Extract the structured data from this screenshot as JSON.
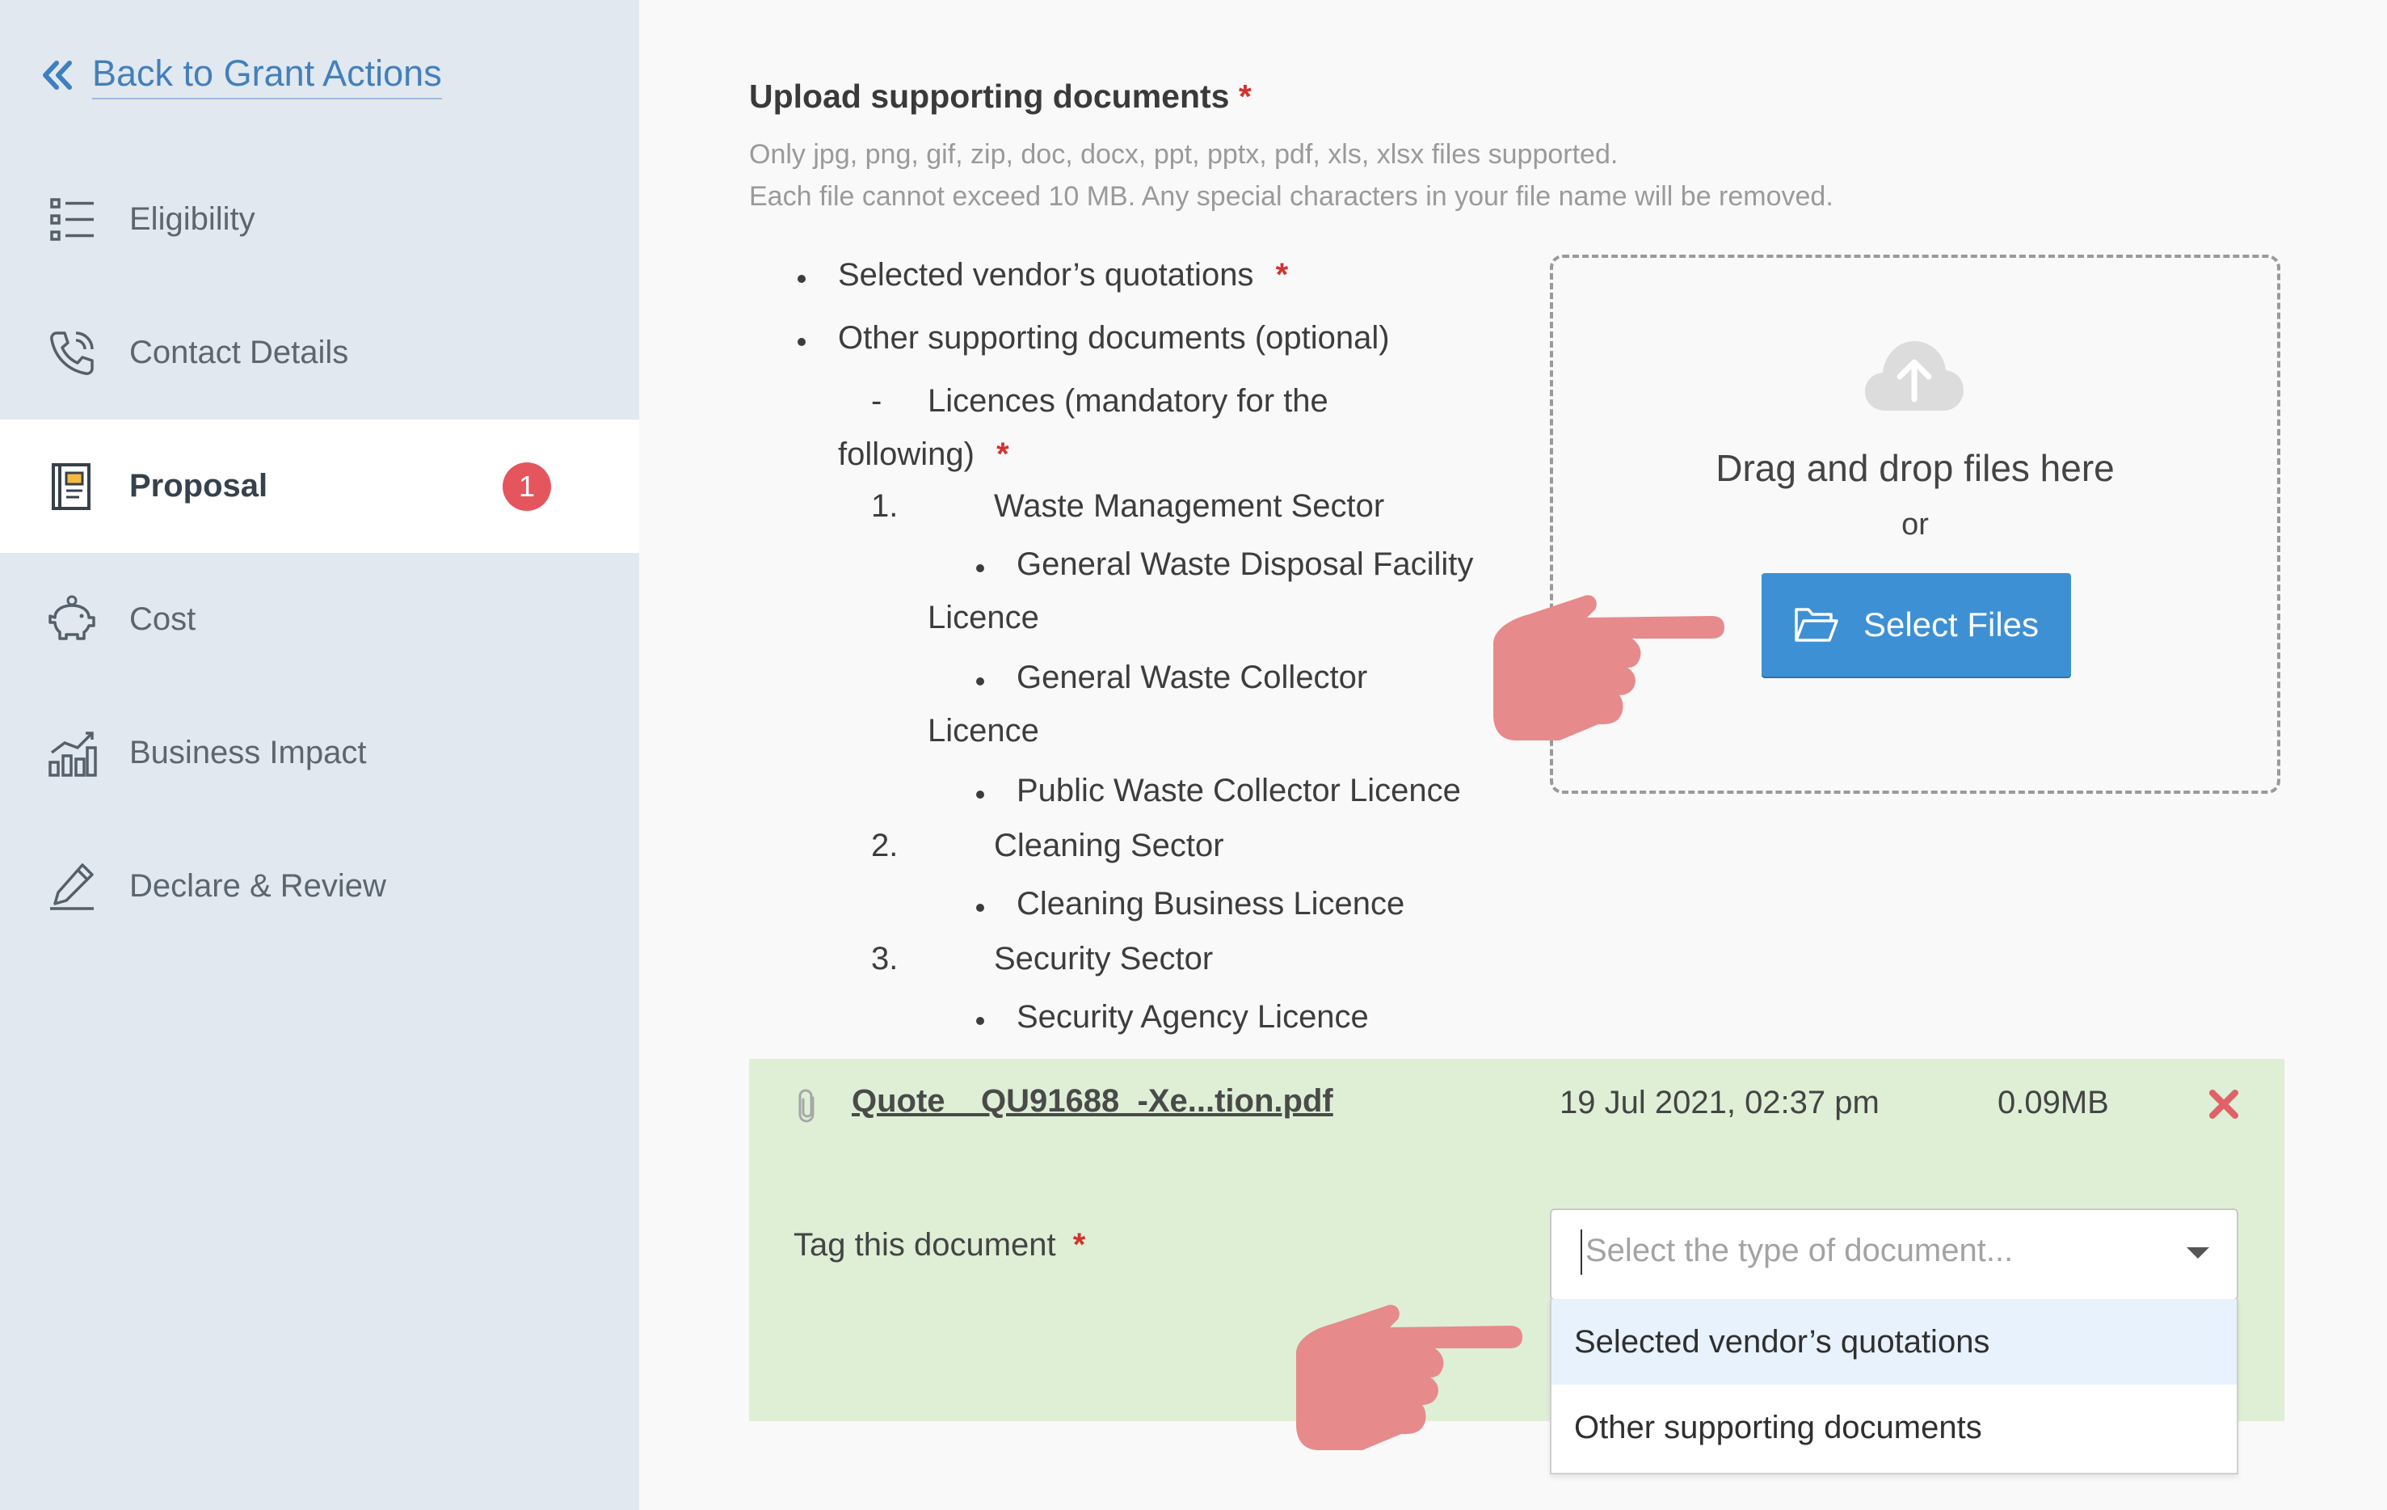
{
  "sidebar": {
    "back_label": "Back to Grant Actions",
    "items": [
      {
        "label": "Eligibility",
        "icon": "list-icon"
      },
      {
        "label": "Contact Details",
        "icon": "phone-icon"
      },
      {
        "label": "Proposal",
        "icon": "notebook-icon",
        "active": true,
        "badge": "1"
      },
      {
        "label": "Cost",
        "icon": "piggy-bank-icon"
      },
      {
        "label": "Business Impact",
        "icon": "bar-chart-icon"
      },
      {
        "label": "Declare & Review",
        "icon": "pen-icon"
      }
    ]
  },
  "upload": {
    "title": "Upload supporting documents",
    "required_mark": "*",
    "help_line1": "Only jpg, png, gif, zip, doc, docx, ppt, pptx, pdf, xls, xlsx files supported.",
    "help_line2": "Each file cannot exceed 10 MB. Any special characters in your file name will be removed.",
    "docs": {
      "quotations": "Selected vendor’s quotations",
      "other": "Other supporting documents (optional)",
      "licences_dash": "-",
      "licences_a": "Licences (mandatory for the",
      "licences_b": "following)",
      "n1": "1.",
      "sector1": "Waste Management Sector",
      "l1a": "General Waste Disposal Facility",
      "l1a_cont": "Licence",
      "l1b": "General Waste Collector",
      "l1b_cont": "Licence",
      "l1c": "Public Waste Collector Licence",
      "n2": "2.",
      "sector2": "Cleaning Sector",
      "l2a": "Cleaning Business Licence",
      "n3": "3.",
      "sector3": "Security Sector",
      "l3a": "Security Agency Licence"
    },
    "dropzone": {
      "drag_text": "Drag and drop files here",
      "or_text": "or",
      "button_label": "Select Files"
    }
  },
  "file": {
    "name": "Quote__QU91688_-Xe...tion.pdf",
    "date": "19 Jul 2021, 02:37 pm",
    "size": "0.09MB",
    "tag_label": "Tag this document",
    "tag_placeholder": "Select the type of document...",
    "options": [
      "Selected vendor’s quotations",
      "Other supporting documents"
    ]
  },
  "colors": {
    "accent": "#3e90d4",
    "success_panel": "#deefd6",
    "badge": "#e5555d",
    "required": "#d0332f",
    "pointer_hand": "#e78a8c"
  }
}
